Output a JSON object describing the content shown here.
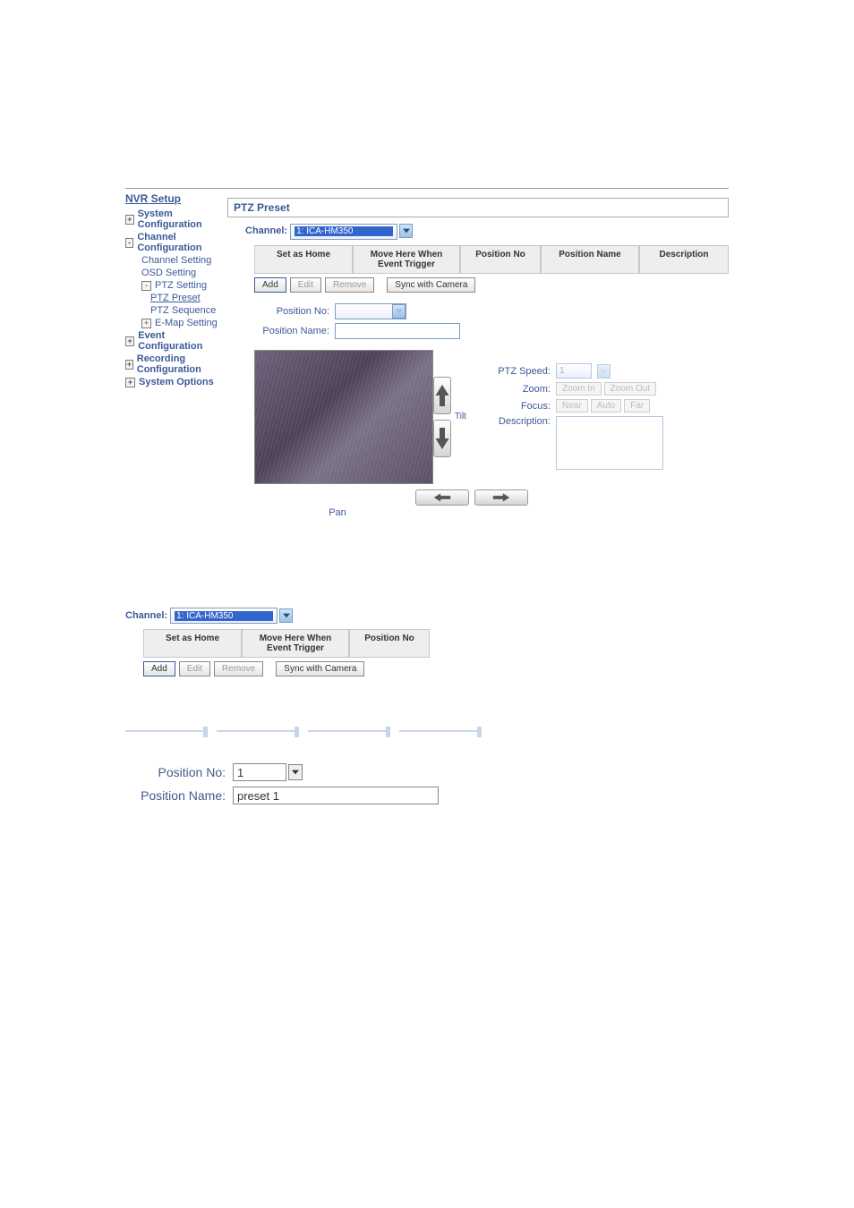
{
  "sidebar": {
    "title": "NVR Setup",
    "items": [
      {
        "label": "System Configuration",
        "bold": true,
        "collapsed": true
      },
      {
        "label": "Channel Configuration",
        "bold": true,
        "collapsed": false
      },
      {
        "label": "Channel Setting",
        "sub": 1
      },
      {
        "label": "OSD Setting",
        "sub": 1
      },
      {
        "label": "PTZ Setting",
        "sub": 1,
        "expander": "-"
      },
      {
        "label": "PTZ Preset",
        "sub": 2,
        "underline": true
      },
      {
        "label": "PTZ Sequence",
        "sub": 2
      },
      {
        "label": "E-Map Setting",
        "sub": 1,
        "expander": "+"
      },
      {
        "label": "Event Configuration",
        "bold": true,
        "collapsed": true
      },
      {
        "label": "Recording Configuration",
        "bold": true,
        "collapsed": true
      },
      {
        "label": "System Options",
        "bold": true,
        "collapsed": true
      }
    ]
  },
  "panel": {
    "title": "PTZ Preset",
    "channelLabel": "Channel:",
    "channelValue": "1: ICA-HM350",
    "tableHeaders": {
      "setAsHome": "Set as Home",
      "moveHere": "Move Here When Event Trigger",
      "positionNo": "Position No",
      "positionName": "Position Name",
      "description": "Description"
    },
    "buttons": {
      "add": "Add",
      "edit": "Edit",
      "remove": "Remove",
      "sync": "Sync with Camera"
    },
    "fields": {
      "positionNoLabel": "Position No:",
      "positionNameLabel": "Position Name:"
    },
    "panLabel": "Pan",
    "tiltLabel": "Tilt",
    "rightControls": {
      "ptzSpeedLabel": "PTZ Speed:",
      "ptzSpeedValue": "1",
      "zoomLabel": "Zoom:",
      "zoomIn": "Zoom In",
      "zoomOut": "Zoom Out",
      "focusLabel": "Focus:",
      "near": "Near",
      "auto": "Auto",
      "far": "Far",
      "descriptionLabel": "Description:"
    }
  },
  "frag2": {
    "channelLabel": "Channel:",
    "channelValue": "1: ICA-HM350",
    "headers": {
      "setAsHome": "Set as Home",
      "moveHere": "Move Here When Event Trigger",
      "positionNo": "Position No"
    }
  },
  "frag3": {
    "positionNoLabel": "Position No:",
    "positionNoValue": "1",
    "positionNameLabel": "Position Name:",
    "positionNameValue": "preset 1"
  }
}
